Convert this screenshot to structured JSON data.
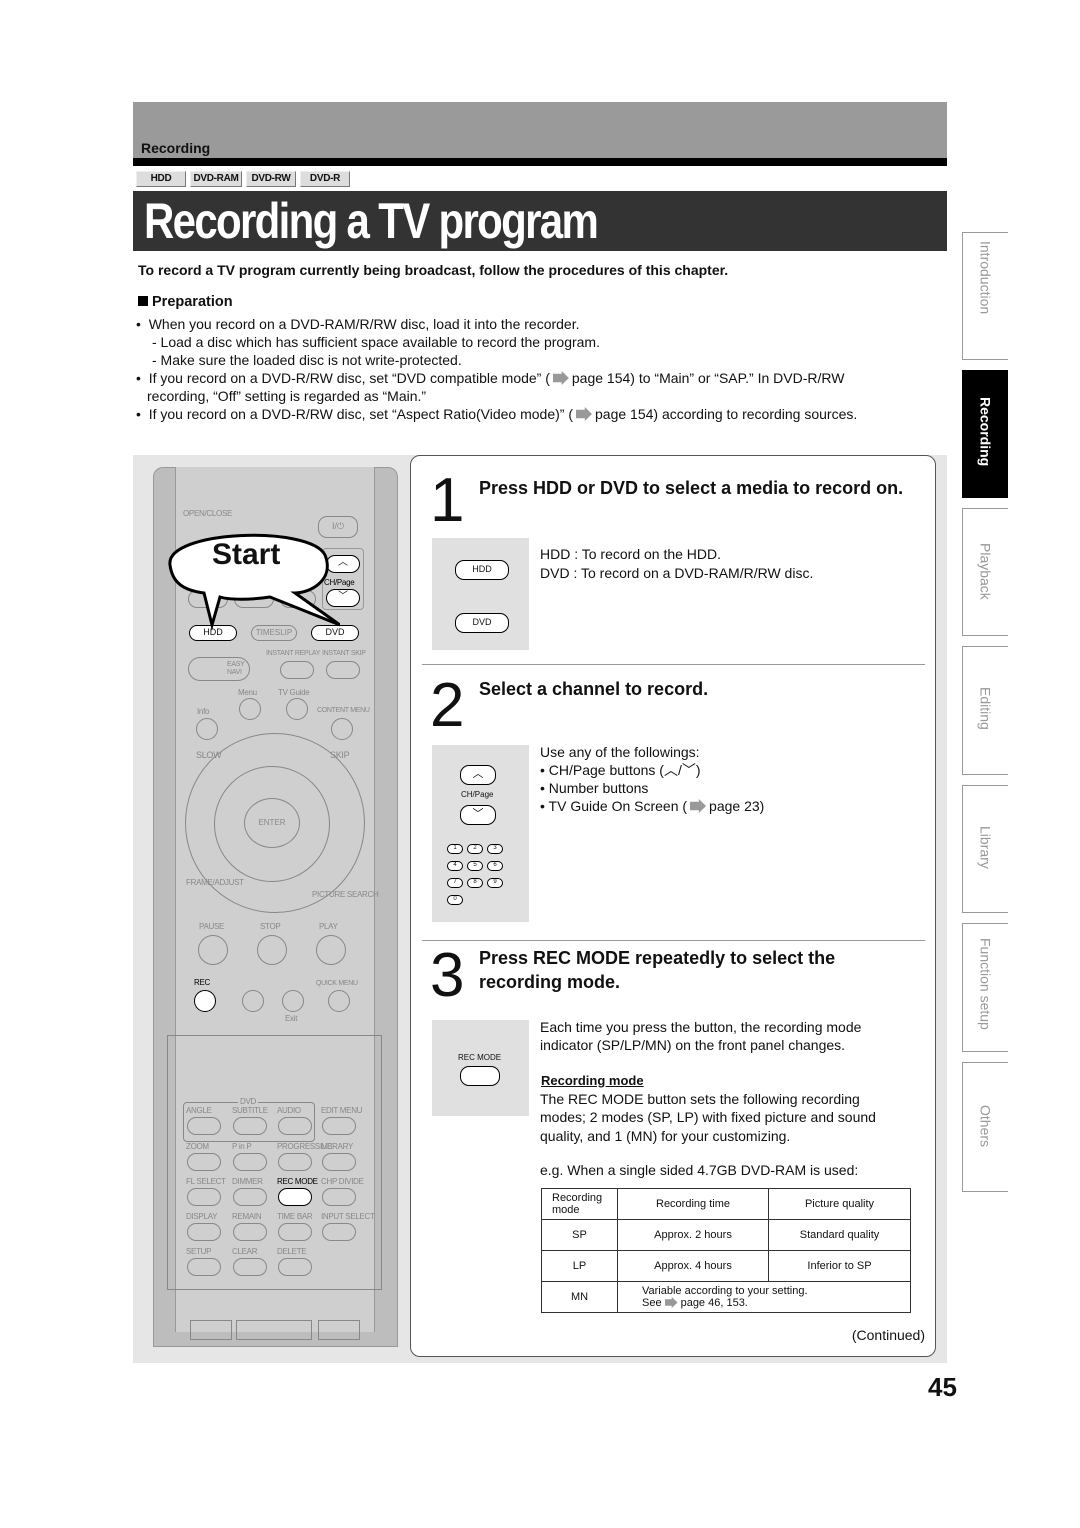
{
  "header": {
    "section": "Recording",
    "media_tags": [
      "HDD",
      "DVD-RAM",
      "DVD-RW",
      "DVD-R"
    ],
    "title": "Recording a TV program"
  },
  "intro": "To record a TV program currently being broadcast, follow the procedures of this chapter.",
  "preparation": {
    "heading": "Preparation",
    "lines": [
      "When you record on a DVD-RAM/R/RW disc, load it into the recorder.",
      "- Load a disc which has sufficient space available to record the program.",
      "- Make sure the loaded disc is not write-protected.",
      "If you record on a DVD-R/RW disc, set “DVD compatible mode” (",
      "page 154) to “Main” or “SAP.” In DVD-R/RW",
      "recording, “Off” setting is regarded as “Main.”",
      "If you record on a DVD-R/RW disc, set “Aspect Ratio(Video mode)” (",
      "page 154) according to recording sources."
    ]
  },
  "remote": {
    "callout": "Start",
    "labels": [
      "OPEN/CLOSE",
      "I/⏻",
      "CH/Page",
      "HDD",
      "TIMESLIP",
      "DVD",
      "INSTANT REPLAY",
      "INSTANT SKIP",
      "EASY NAVI",
      "Menu",
      "TV Guide",
      "Info",
      "CONTENT MENU",
      "SLOW",
      "SKIP",
      "ENTER",
      "FRAME/ADJUST",
      "PICTURE SEARCH",
      "PAUSE",
      "STOP",
      "PLAY",
      "REC",
      "QUICK MENU",
      "Exit",
      "DVD",
      "ANGLE",
      "SUBTITLE",
      "AUDIO",
      "EDIT MENU",
      "ZOOM",
      "P in P",
      "PROGRESSIVE",
      "LIBRARY",
      "FL SELECT",
      "DIMMER",
      "REC MODE",
      "CHP DIVIDE",
      "DISPLAY",
      "REMAIN",
      "TIME BAR",
      "INPUT SELECT",
      "SETUP",
      "CLEAR",
      "DELETE"
    ]
  },
  "steps": [
    {
      "number": "1",
      "heading": "Press HDD or DVD to select a media to record on.",
      "buttons": [
        "HDD",
        "DVD"
      ],
      "lines": [
        "HDD : To record on the HDD.",
        "DVD : To record on a DVD-RAM/R/RW disc."
      ]
    },
    {
      "number": "2",
      "heading": "Select a channel to record.",
      "button_label": "CH/Page",
      "keypad": [
        "1",
        "2",
        "3",
        "4",
        "5",
        "6",
        "7",
        "8",
        "9",
        "0"
      ],
      "lines": [
        "Use any of the followings:",
        "• CH/Page buttons (",
        "/",
        ")",
        "• Number buttons",
        "• TV Guide On Screen (",
        "page 23)"
      ]
    },
    {
      "number": "3",
      "heading": "Press REC MODE repeatedly to select the recording mode.",
      "button_label": "REC MODE",
      "lines": [
        "Each time you press the button, the recording mode",
        "indicator (SP/LP/MN) on the front panel changes."
      ],
      "subheading": "Recording mode",
      "desc": [
        "The REC MODE button sets the following recording",
        "modes; 2 modes (SP, LP) with fixed picture and sound",
        "quality, and 1 (MN) for your customizing."
      ],
      "example": "e.g. When a single sided 4.7GB DVD-RAM is used:"
    }
  ],
  "table": {
    "headers": [
      "Recording mode",
      "Recording time",
      "Picture quality"
    ],
    "rows": [
      [
        "SP",
        "Approx. 2 hours",
        "Standard quality"
      ],
      [
        "LP",
        "Approx. 4 hours",
        "Inferior to SP"
      ]
    ],
    "mn": {
      "mode": "MN",
      "line1": "Variable according to your setting.",
      "see": "See",
      "pages": "page 46, 153."
    }
  },
  "continued": "(Continued)",
  "side_tabs": [
    {
      "label": "Introduction",
      "active": false
    },
    {
      "label": "Recording",
      "active": true
    },
    {
      "label": "Playback",
      "active": false
    },
    {
      "label": "Editing",
      "active": false
    },
    {
      "label": "Library",
      "active": false
    },
    {
      "label": "Function setup",
      "active": false
    },
    {
      "label": "Others",
      "active": false
    }
  ],
  "page_number": "45"
}
